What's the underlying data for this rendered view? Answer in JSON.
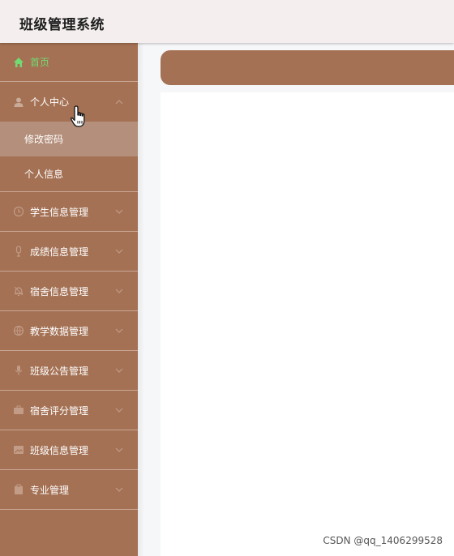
{
  "app": {
    "title": "班级管理系统"
  },
  "sidebar": {
    "home": {
      "label": "首页",
      "icon": "home-icon"
    },
    "personal_center": {
      "label": "个人中心",
      "icon": "user-icon",
      "expanded": true,
      "children": [
        {
          "label": "修改密码",
          "active": true
        },
        {
          "label": "个人信息",
          "active": false
        }
      ]
    },
    "items": [
      {
        "label": "学生信息管理",
        "icon": "clock-icon"
      },
      {
        "label": "成绩信息管理",
        "icon": "microphone-icon"
      },
      {
        "label": "宿舍信息管理",
        "icon": "bell-icon"
      },
      {
        "label": "教学数据管理",
        "icon": "globe-icon"
      },
      {
        "label": "班级公告管理",
        "icon": "mic-icon"
      },
      {
        "label": "宿舍评分管理",
        "icon": "briefcase-icon"
      },
      {
        "label": "班级信息管理",
        "icon": "image-icon"
      },
      {
        "label": "专业管理",
        "icon": "clipboard-icon"
      }
    ]
  },
  "colors": {
    "sidebar_bg": "#a47154",
    "submenu_active": "#b48f7b",
    "home_accent": "#73d973",
    "header_bg": "#f4efee"
  },
  "watermark": "CSDN @qq_1406299528"
}
